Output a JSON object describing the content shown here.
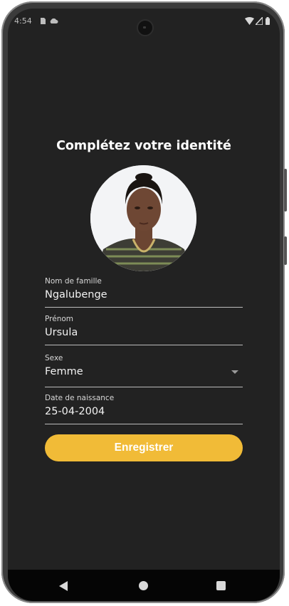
{
  "status_bar": {
    "time": "4:54",
    "icons": [
      "sim-card-icon",
      "cloud-icon",
      "wifi-icon",
      "signal-icon",
      "battery-icon"
    ]
  },
  "page": {
    "title": "Complétez votre identité"
  },
  "form": {
    "last_name": {
      "label": "Nom de famille",
      "value": "Ngalubenge"
    },
    "first_name": {
      "label": "Prénom",
      "value": "Ursula"
    },
    "sex": {
      "label": "Sexe",
      "value": "Femme"
    },
    "birth_date": {
      "label": "Date de naissance",
      "value": "25-04-2004"
    }
  },
  "actions": {
    "save_label": "Enregistrer"
  },
  "nav_bar": {
    "icons": [
      "back-icon",
      "home-icon",
      "recents-icon"
    ]
  },
  "colors": {
    "background": "#222222",
    "accent": "#f1bb37",
    "text": "#ffffff",
    "nav_bar": "#050505"
  }
}
